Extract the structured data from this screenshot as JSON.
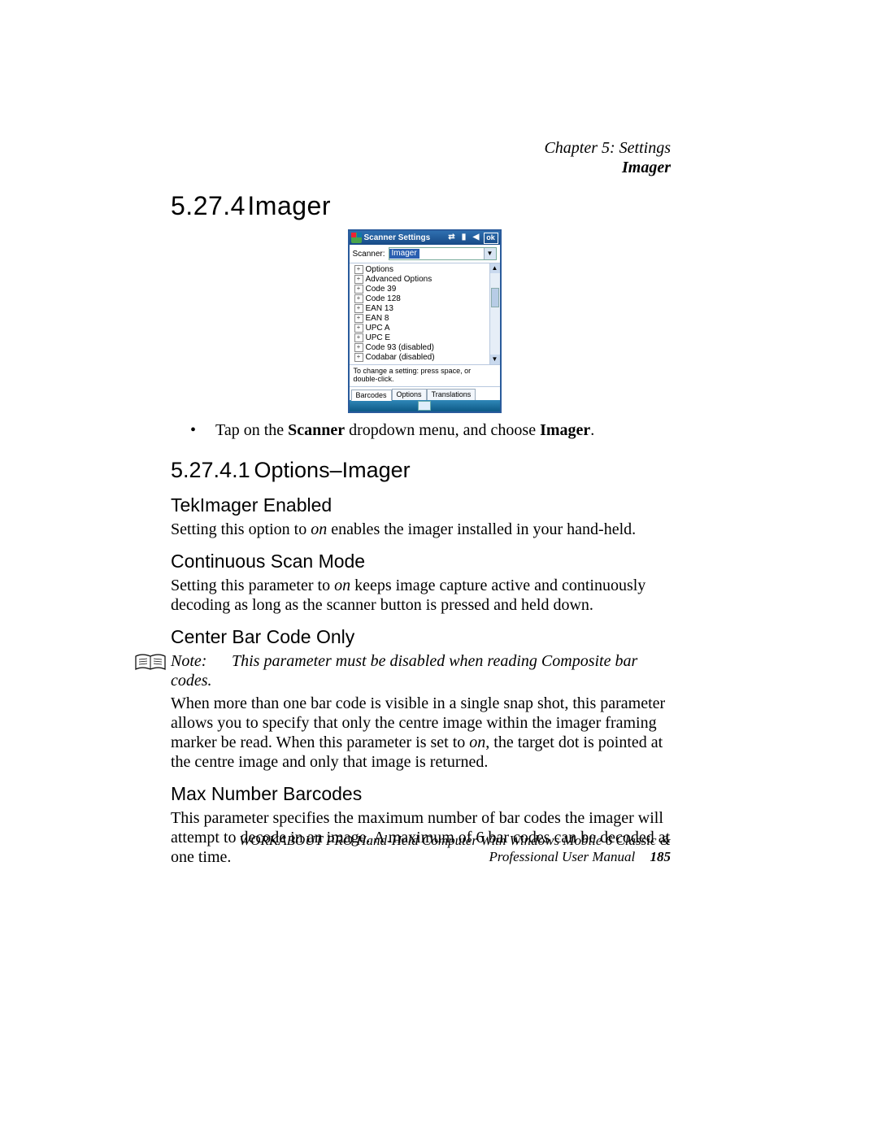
{
  "header": {
    "line1": "Chapter 5: Settings",
    "line2": "Imager"
  },
  "h_main": {
    "num": "5.27.4",
    "title": "Imager"
  },
  "shot": {
    "title": "Scanner Settings",
    "ok": "ok",
    "scanner_label": "Scanner:",
    "scanner_value": "Imager",
    "tree": [
      "Options",
      "Advanced Options",
      "Code 39",
      "Code 128",
      "EAN 13",
      "EAN 8",
      "UPC A",
      "UPC E",
      "Code 93 (disabled)",
      "Codabar (disabled)"
    ],
    "hint": "To change a setting: press space, or double-click.",
    "tabs": [
      "Barcodes",
      "Options",
      "Translations"
    ]
  },
  "bullet1": {
    "pre": "Tap on the ",
    "b1": "Scanner",
    "mid": " dropdown menu, and choose ",
    "b2": "Imager",
    "post": "."
  },
  "h_sub": {
    "num": "5.27.4.1",
    "title": "Options–Imager"
  },
  "s1": {
    "h": "TekImager Enabled",
    "p_a": "Setting this option to ",
    "p_i": "on",
    "p_b": " enables the imager installed in your hand-held."
  },
  "s2": {
    "h": "Continuous Scan Mode",
    "p_a": "Setting this parameter to ",
    "p_i": "on",
    "p_b": " keeps image capture active and continuously decoding as long as the scanner button is pressed and held down."
  },
  "s3": {
    "h": "Center Bar Code Only",
    "note_label": "Note:",
    "note_text": "This parameter must be disabled when reading Composite bar codes.",
    "p_a": "When more than one bar code is visible in a single snap shot, this parameter allows you to specify that only the centre image within the imager framing marker be read. When this parameter is set to ",
    "p_i": "on",
    "p_b": ", the target dot is pointed at the centre image and only that image is returned."
  },
  "s4": {
    "h": "Max Number Barcodes",
    "p": "This parameter specifies the maximum number of bar codes the imager will attempt to decode in an image. A maximum of 6 bar codes can be decoded at one time."
  },
  "footer": {
    "text": "WORKABOUT PRO Hand-Held Computer With Windows Mobile 6 Classic & Professional User Manual",
    "page": "185"
  }
}
